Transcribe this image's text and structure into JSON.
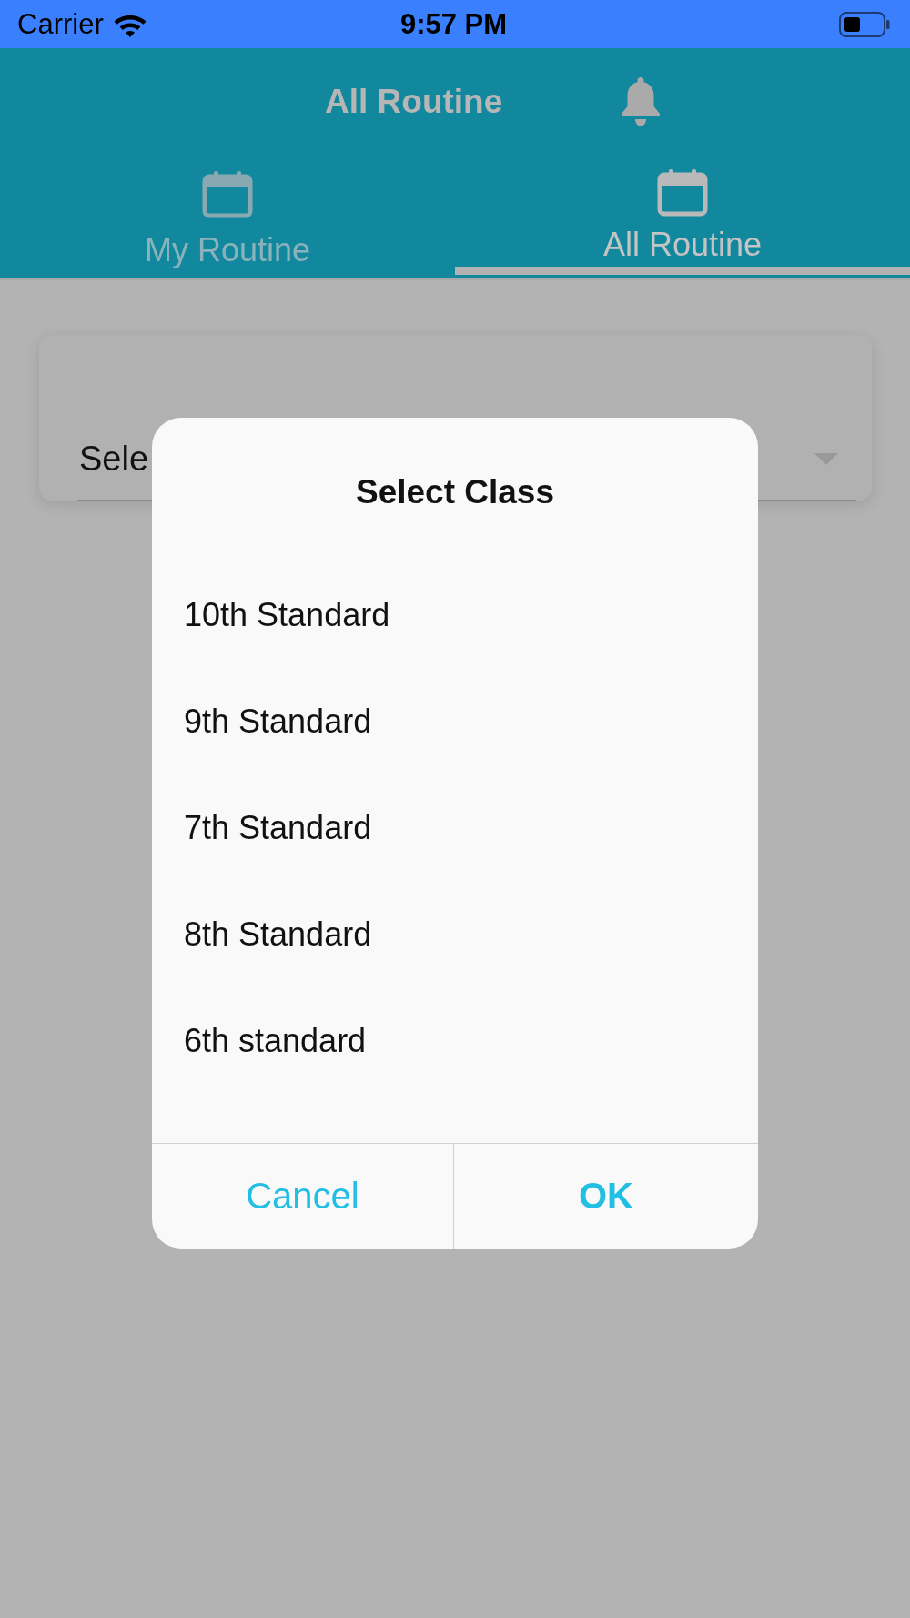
{
  "status_bar": {
    "carrier": "Carrier",
    "time": "9:57 PM"
  },
  "header": {
    "title": "All Routine"
  },
  "tabs": [
    {
      "label": "My Routine",
      "selected": false
    },
    {
      "label": "All Routine",
      "selected": true
    }
  ],
  "class_select": {
    "value": "Sele"
  },
  "dialog": {
    "title": "Select Class",
    "options": [
      "10th Standard",
      "9th Standard",
      "7th Standard",
      "8th Standard",
      "6th standard"
    ],
    "buttons": [
      {
        "label": "Cancel",
        "kind": "cancel"
      },
      {
        "label": "OK",
        "kind": "confirm"
      }
    ]
  }
}
